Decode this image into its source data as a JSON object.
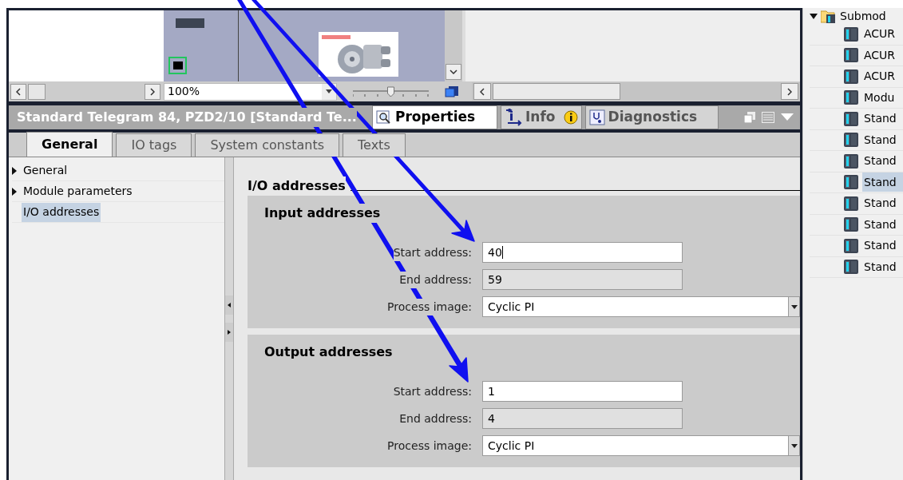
{
  "device_view": {
    "zoom": "100%",
    "zoom_slider": {
      "level": 0.5
    }
  },
  "properties_panel": {
    "title": "Standard Telegram 84, PZD2/10 [Standard Te...",
    "panel_tabs": [
      {
        "label": "Properties",
        "kind": "properties",
        "selected": true
      },
      {
        "label": "Info",
        "kind": "info",
        "selected": false
      },
      {
        "label": "Diagnostics",
        "kind": "diagnostics",
        "selected": false
      }
    ],
    "tabs": [
      {
        "label": "General",
        "selected": true
      },
      {
        "label": "IO tags",
        "selected": false
      },
      {
        "label": "System constants",
        "selected": false
      },
      {
        "label": "Texts",
        "selected": false
      }
    ],
    "nav": [
      {
        "label": "General",
        "kind": "group",
        "selected": false
      },
      {
        "label": "Module parameters",
        "kind": "group",
        "selected": false
      },
      {
        "label": "I/O addresses",
        "kind": "leaf",
        "selected": true
      }
    ],
    "section_title": "I/O addresses",
    "groups": [
      {
        "title": "Input addresses",
        "fields": [
          {
            "label": "Start address:",
            "value": "40",
            "kind": "input",
            "focused": true
          },
          {
            "label": "End address:",
            "value": "59",
            "kind": "readonly",
            "focused": false
          },
          {
            "label": "Process image:",
            "value": "Cyclic PI",
            "kind": "dropdown",
            "focused": false
          }
        ]
      },
      {
        "title": "Output addresses",
        "fields": [
          {
            "label": "Start address:",
            "value": "1",
            "kind": "input",
            "focused": false
          },
          {
            "label": "End address:",
            "value": "4",
            "kind": "readonly",
            "focused": false
          },
          {
            "label": "Process image:",
            "value": "Cyclic PI",
            "kind": "dropdown",
            "focused": false
          }
        ]
      }
    ]
  },
  "catalog": {
    "label": "Submod",
    "expanded": true,
    "children": [
      {
        "label": "ACUR",
        "selected": false
      },
      {
        "label": "ACUR",
        "selected": false
      },
      {
        "label": "ACUR",
        "selected": false
      },
      {
        "label": "Modu",
        "selected": false
      },
      {
        "label": "Stand",
        "selected": false
      },
      {
        "label": "Stand",
        "selected": false
      },
      {
        "label": "Stand",
        "selected": false
      },
      {
        "label": "Stand",
        "selected": true
      },
      {
        "label": "Stand",
        "selected": false
      },
      {
        "label": "Stand",
        "selected": false
      },
      {
        "label": "Stand",
        "selected": false
      },
      {
        "label": "Stand",
        "selected": false
      }
    ]
  }
}
